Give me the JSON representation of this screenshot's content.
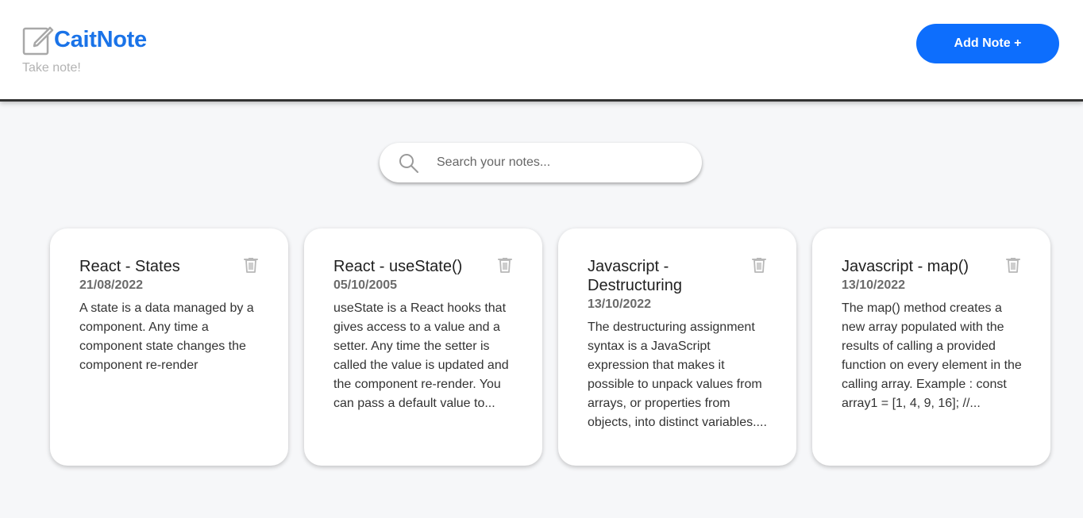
{
  "app": {
    "title": "CaitNote",
    "tagline": "Take note!",
    "add_button_label": "Add Note +",
    "icons": {
      "brand": "edit-note-icon",
      "search": "search-icon",
      "delete": "trash-icon"
    },
    "colors": {
      "accent": "#1a73e8",
      "button": "#0d6efd",
      "background": "#f6f7f9",
      "card": "#ffffff"
    }
  },
  "search": {
    "placeholder": "Search your notes...",
    "value": ""
  },
  "notes": [
    {
      "title": "React - States",
      "date": "21/08/2022",
      "body": "A state is a data managed by a component. Any time a component state changes the component re-render"
    },
    {
      "title": "React - useState()",
      "date": "05/10/2005",
      "body": "useState is a React hooks that gives access to a value and a setter. Any time the setter is called the value is updated and the component re-render. You can pass a default value to..."
    },
    {
      "title": "Javascript - Destructuring",
      "date": "13/10/2022",
      "body": "The destructuring assignment syntax is a JavaScript expression that makes it possible to unpack values from arrays, or properties from objects, into distinct variables...."
    },
    {
      "title": "Javascript - map()",
      "date": "13/10/2022",
      "body": "The map() method creates a new array populated with the results of calling a provided function on every element in the calling array. Example : const array1 = [1, 4, 9, 16]; //..."
    }
  ]
}
